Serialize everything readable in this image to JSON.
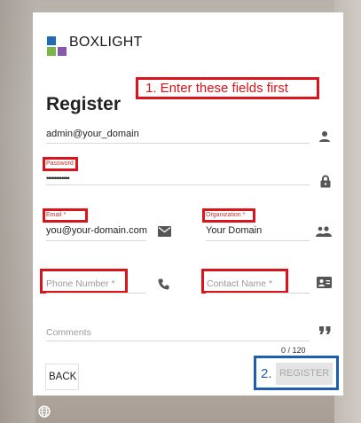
{
  "brand": {
    "name": "BOXLIGHT",
    "colors": [
      "#1f6bb5",
      "#7ab648",
      "#5a3c8f",
      "#8a57b0"
    ]
  },
  "page": {
    "title": "Register"
  },
  "annotations": {
    "step1": "1. Enter these fields first",
    "step2_number": "2.",
    "accent_red": "#d9151b",
    "accent_blue": "#1c5fae"
  },
  "form": {
    "username": {
      "value": "admin@your_domain",
      "icon": "person-icon"
    },
    "password": {
      "label": "Password *",
      "value": "••••••••••••",
      "icon": "lock-icon"
    },
    "email": {
      "label": "Email *",
      "value": "you@your-domain.com",
      "icon": "envelope-icon"
    },
    "organization": {
      "label": "Organization *",
      "value": "Your Domain",
      "icon": "group-icon"
    },
    "phone": {
      "placeholder": "Phone Number *",
      "icon": "phone-icon"
    },
    "contact": {
      "placeholder": "Contact Name *",
      "icon": "contact-card-icon"
    },
    "comments": {
      "placeholder": "Comments",
      "icon": "quote-icon",
      "counter": "0 / 120"
    }
  },
  "buttons": {
    "back": "BACK",
    "register": "REGISTER"
  },
  "footer": {
    "icon": "globe-icon"
  }
}
